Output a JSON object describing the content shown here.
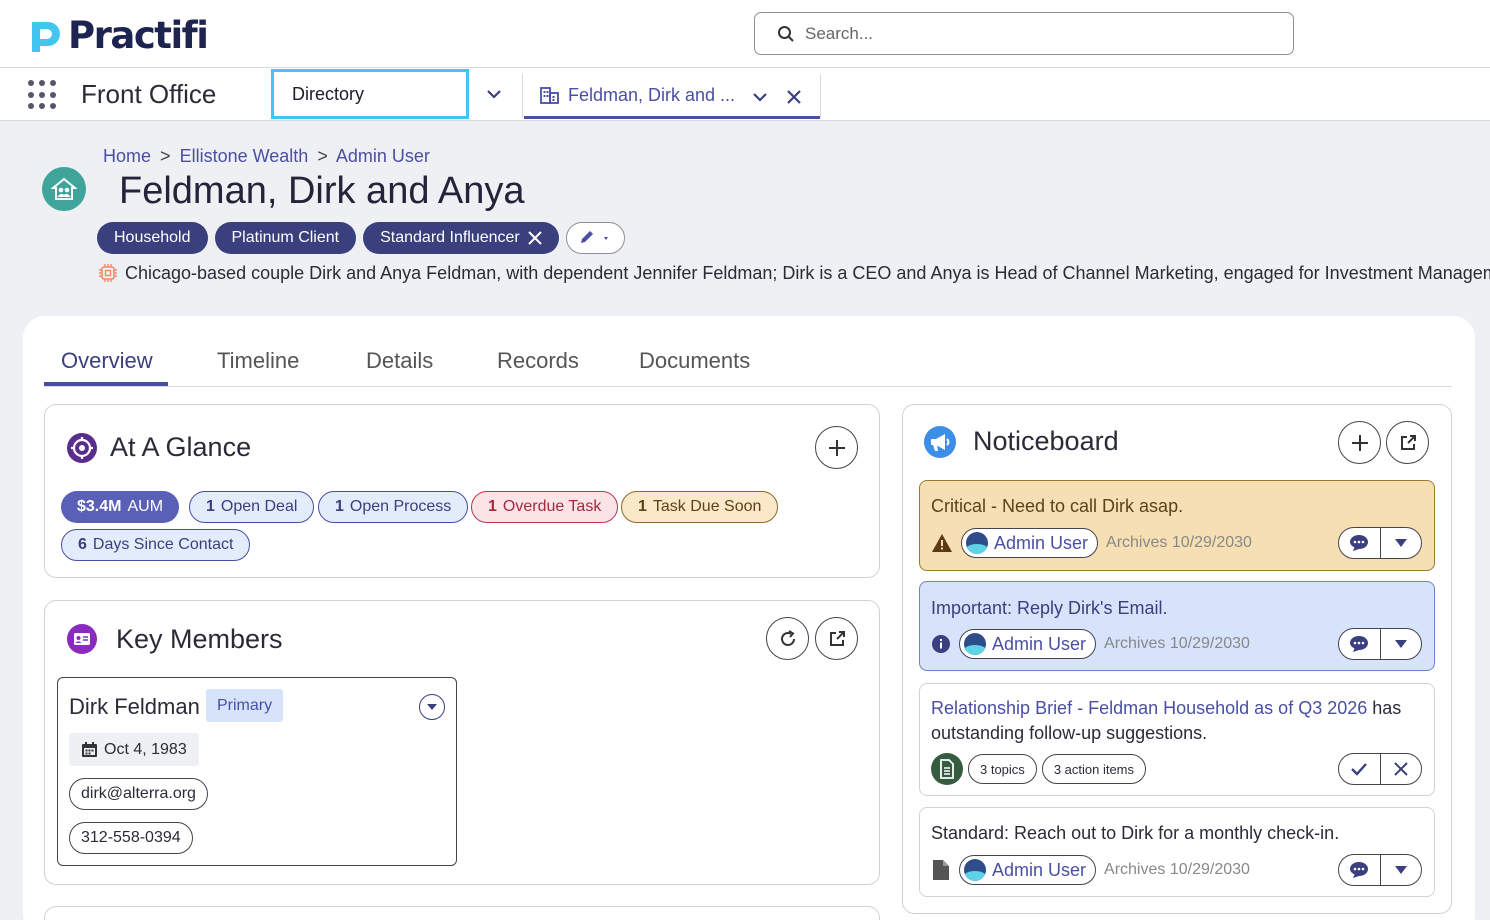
{
  "brand": {
    "name": "Practifi",
    "accent": "#4a4fa3",
    "logo_color": "#42c6ef"
  },
  "search": {
    "placeholder": "Search..."
  },
  "nav": {
    "app_name": "Front Office",
    "directory_label": "Directory",
    "open_tab_label": "Feldman, Dirk and ..."
  },
  "breadcrumb": {
    "items": [
      "Home",
      "Ellistone Wealth",
      "Admin User"
    ],
    "separator": ">"
  },
  "record": {
    "title": "Feldman, Dirk and Anya",
    "tags": [
      "Household",
      "Platinum Client",
      "Standard Influencer"
    ],
    "summary": "Chicago-based couple Dirk and Anya Feldman, with dependent Jennifer Feldman; Dirk is a CEO and Anya is Head of Channel Marketing, engaged for Investment Management and"
  },
  "tabs": [
    "Overview",
    "Timeline",
    "Details",
    "Records",
    "Documents"
  ],
  "at_a_glance": {
    "title": "At A Glance",
    "chips": [
      {
        "count": "$3.4M",
        "label": "AUM"
      },
      {
        "count": "1",
        "label": "Open Deal"
      },
      {
        "count": "1",
        "label": "Open Process"
      },
      {
        "count": "1",
        "label": "Overdue Task"
      },
      {
        "count": "1",
        "label": "Task Due Soon"
      },
      {
        "count": "6",
        "label": "Days Since Contact"
      }
    ]
  },
  "key_members": {
    "title": "Key Members",
    "member": {
      "name": "Dirk Feldman",
      "badge": "Primary",
      "dob": "Oct 4, 1983",
      "email": "dirk@alterra.org",
      "phone": "312-558-0394"
    }
  },
  "noticeboard": {
    "title": "Noticeboard",
    "items": [
      {
        "text": "Critical - Need to call Dirk asap.",
        "user": "Admin User",
        "archives": "Archives 10/29/2030"
      },
      {
        "text": "Important: Reply Dirk's Email.",
        "user": "Admin User",
        "archives": "Archives 10/29/2030"
      },
      {
        "link": "Relationship Brief - Feldman Household as of Q3 2026",
        "text": " has outstanding follow-up suggestions.",
        "chips": [
          "3 topics",
          "3 action items"
        ]
      },
      {
        "text": "Standard: Reach out to Dirk for a monthly check-in.",
        "user": "Admin User",
        "archives": "Archives 10/29/2030"
      }
    ]
  }
}
